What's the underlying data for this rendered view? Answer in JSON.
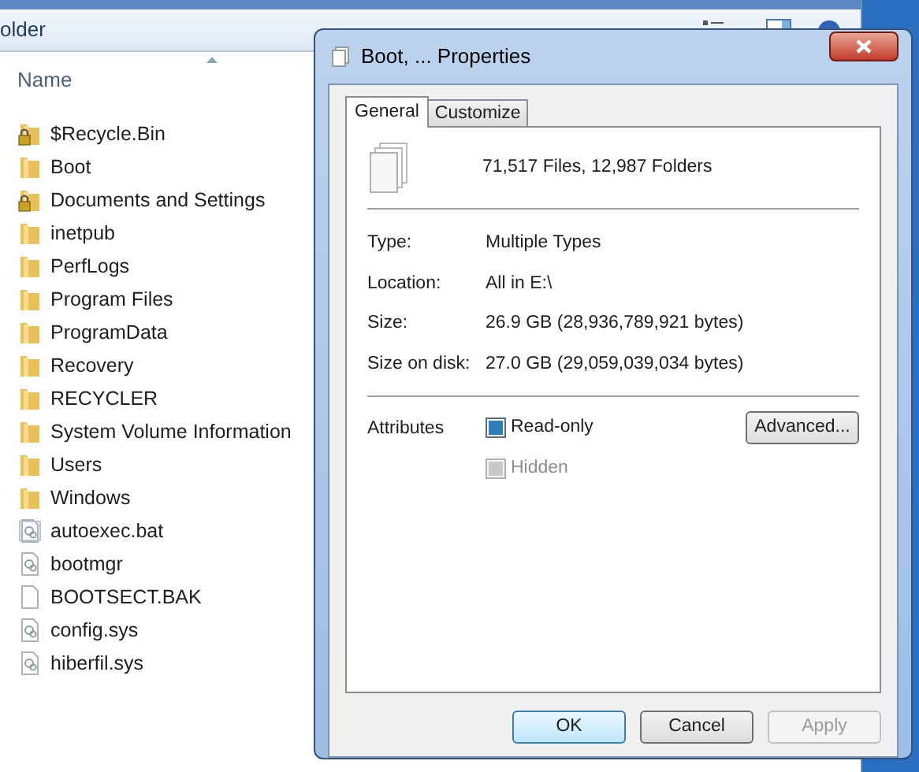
{
  "explorer": {
    "title": "older",
    "column_header": "Name",
    "items": [
      {
        "name": "$Recycle.Bin",
        "kind": "locked-folder"
      },
      {
        "name": "Boot",
        "kind": "folder"
      },
      {
        "name": "Documents and Settings",
        "kind": "locked-folder"
      },
      {
        "name": "inetpub",
        "kind": "folder"
      },
      {
        "name": "PerfLogs",
        "kind": "folder"
      },
      {
        "name": "Program Files",
        "kind": "folder"
      },
      {
        "name": "ProgramData",
        "kind": "folder"
      },
      {
        "name": "Recovery",
        "kind": "folder"
      },
      {
        "name": "RECYCLER",
        "kind": "folder"
      },
      {
        "name": "System Volume Information",
        "kind": "folder"
      },
      {
        "name": "Users",
        "kind": "folder"
      },
      {
        "name": "Windows",
        "kind": "folder"
      },
      {
        "name": "autoexec.bat",
        "kind": "settings-file"
      },
      {
        "name": "bootmgr",
        "kind": "system-file"
      },
      {
        "name": "BOOTSECT.BAK",
        "kind": "file"
      },
      {
        "name": "config.sys",
        "kind": "system-file"
      },
      {
        "name": "hiberfil.sys",
        "kind": "system-file"
      }
    ]
  },
  "dialog": {
    "title": "Boot, ... Properties",
    "tabs": [
      {
        "label": "General",
        "selected": true
      },
      {
        "label": "Customize",
        "selected": false
      }
    ],
    "summary": "71,517 Files, 12,987 Folders",
    "properties": [
      {
        "label": "Type:",
        "value": "Multiple Types"
      },
      {
        "label": "Location:",
        "value": "All in E:\\"
      },
      {
        "label": "Size:",
        "value": "26.9 GB (28,936,789,921 bytes)"
      },
      {
        "label": "Size on disk:",
        "value": "27.0 GB (29,059,039,034 bytes)"
      }
    ],
    "attributes_label": "Attributes",
    "attributes": [
      {
        "label": "Read-only",
        "checked": true,
        "disabled": false
      },
      {
        "label": "Hidden",
        "checked": false,
        "disabled": true
      }
    ],
    "advanced_button": "Advanced...",
    "buttons": [
      {
        "label": "OK",
        "default": true,
        "disabled": false
      },
      {
        "label": "Cancel",
        "default": false,
        "disabled": false
      },
      {
        "label": "Apply",
        "default": false,
        "disabled": true
      }
    ]
  }
}
